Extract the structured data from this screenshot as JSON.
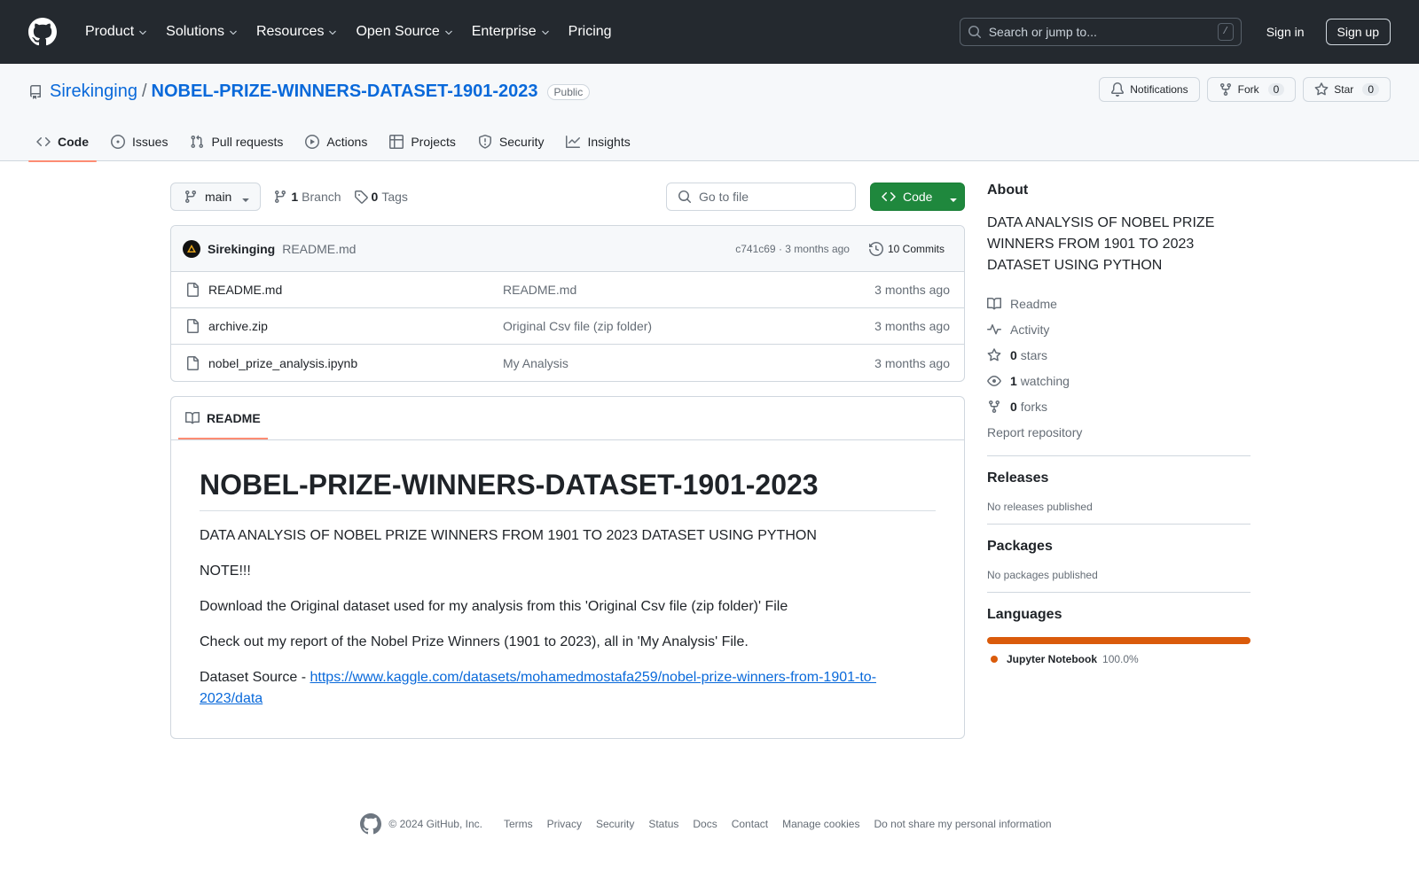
{
  "header": {
    "nav": [
      {
        "label": "Product",
        "dropdown": true
      },
      {
        "label": "Solutions",
        "dropdown": true
      },
      {
        "label": "Resources",
        "dropdown": true
      },
      {
        "label": "Open Source",
        "dropdown": true
      },
      {
        "label": "Enterprise",
        "dropdown": true
      },
      {
        "label": "Pricing",
        "dropdown": false
      }
    ],
    "search_placeholder": "Search or jump to...",
    "search_shortcut": "/",
    "sign_in": "Sign in",
    "sign_up": "Sign up"
  },
  "repo": {
    "owner": "Sirekinging",
    "separator": "/",
    "name": "NOBEL-PRIZE-WINNERS-DATASET-1901-2023",
    "visibility": "Public",
    "notifications_label": "Notifications",
    "fork_label": "Fork",
    "fork_count": "0",
    "star_label": "Star",
    "star_count": "0",
    "tabs": [
      {
        "label": "Code",
        "icon": "code-icon",
        "active": true
      },
      {
        "label": "Issues",
        "icon": "issue-icon",
        "active": false
      },
      {
        "label": "Pull requests",
        "icon": "pull-request-icon",
        "active": false
      },
      {
        "label": "Actions",
        "icon": "play-icon",
        "active": false
      },
      {
        "label": "Projects",
        "icon": "table-icon",
        "active": false
      },
      {
        "label": "Security",
        "icon": "shield-icon",
        "active": false
      },
      {
        "label": "Insights",
        "icon": "graph-icon",
        "active": false
      }
    ]
  },
  "toolbar": {
    "branch": "main",
    "branch_count": "1",
    "branch_label": "Branch",
    "tag_count": "0",
    "tag_label": "Tags",
    "goto_file_placeholder": "Go to file",
    "code_button": "Code"
  },
  "commit": {
    "author": "Sirekinging",
    "message": "README.md",
    "hash_time": "c741c69 · 3 months ago",
    "count_label": "10 Commits"
  },
  "files": [
    {
      "name": "README.md",
      "message": "README.md",
      "time": "3 months ago"
    },
    {
      "name": "archive.zip",
      "message": "Original Csv file (zip folder)",
      "time": "3 months ago"
    },
    {
      "name": "nobel_prize_analysis.ipynb",
      "message": "My Analysis",
      "time": "3 months ago"
    }
  ],
  "readme": {
    "tab_label": "README",
    "title": "NOBEL-PRIZE-WINNERS-DATASET-1901-2023",
    "paragraphs": [
      "DATA ANALYSIS OF NOBEL PRIZE WINNERS FROM 1901 TO 2023 DATASET USING PYTHON",
      "NOTE!!!",
      "Download the Original dataset used for my analysis from this 'Original Csv file (zip folder)' File",
      "Check out my report of the Nobel Prize Winners (1901 to 2023), all in 'My Analysis' File."
    ],
    "source_prefix": "Dataset Source - ",
    "source_link": "https://www.kaggle.com/datasets/mohamedmostafa259/nobel-prize-winners-from-1901-to-2023/data"
  },
  "sidebar": {
    "about_heading": "About",
    "about_description": "DATA ANALYSIS OF NOBEL PRIZE WINNERS FROM 1901 TO 2023 DATASET USING PYTHON",
    "readme_label": "Readme",
    "activity_label": "Activity",
    "stars_count": "0",
    "stars_label": "stars",
    "watching_count": "1",
    "watching_label": "watching",
    "forks_count": "0",
    "forks_label": "forks",
    "report_label": "Report repository",
    "releases_heading": "Releases",
    "releases_note": "No releases published",
    "packages_heading": "Packages",
    "packages_note": "No packages published",
    "languages_heading": "Languages",
    "languages": [
      {
        "name": "Jupyter Notebook",
        "percent": "100.0%",
        "color": "#da5b0b"
      }
    ]
  },
  "footer": {
    "copyright": "© 2024 GitHub, Inc.",
    "links": [
      "Terms",
      "Privacy",
      "Security",
      "Status",
      "Docs",
      "Contact",
      "Manage cookies",
      "Do not share my personal information"
    ]
  },
  "colors": {
    "header_bg": "#24292f",
    "accent_link": "#0969da",
    "code_button": "#1f883d",
    "tab_underline": "#fd8c73"
  }
}
